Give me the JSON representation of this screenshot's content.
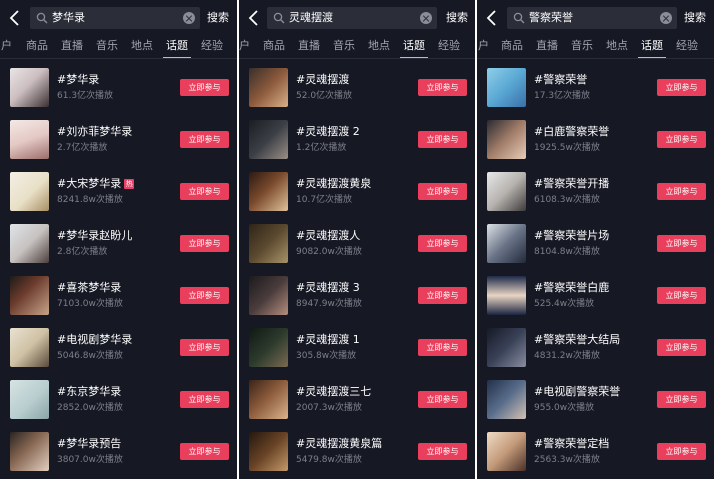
{
  "panels": [
    {
      "query": "梦华录",
      "search_label": "搜索",
      "tabs": [
        "户",
        "商品",
        "直播",
        "音乐",
        "地点",
        "话题",
        "经验"
      ],
      "active_tab": "话题",
      "topics": [
        {
          "title": "#梦华录",
          "plays": "61.3亿次播放",
          "join": "立即参与",
          "hot": false
        },
        {
          "title": "#刘亦菲梦华录",
          "plays": "2.7亿次播放",
          "join": "立即参与",
          "hot": false
        },
        {
          "title": "#大宋梦华录",
          "plays": "8241.8w次播放",
          "join": "立即参与",
          "hot": true,
          "hot_badge": "热"
        },
        {
          "title": "#梦华录赵盼儿",
          "plays": "2.8亿次播放",
          "join": "立即参与",
          "hot": false
        },
        {
          "title": "#喜茶梦华录",
          "plays": "7103.0w次播放",
          "join": "立即参与",
          "hot": false
        },
        {
          "title": "#电视剧梦华录",
          "plays": "5046.8w次播放",
          "join": "立即参与",
          "hot": false
        },
        {
          "title": "#东京梦华录",
          "plays": "2852.0w次播放",
          "join": "立即参与",
          "hot": false
        },
        {
          "title": "#梦华录预告",
          "plays": "3807.0w次播放",
          "join": "立即参与",
          "hot": false
        }
      ]
    },
    {
      "query": "灵魂摆渡",
      "search_label": "搜索",
      "tabs": [
        "户",
        "商品",
        "直播",
        "音乐",
        "地点",
        "话题",
        "经验"
      ],
      "active_tab": "话题",
      "topics": [
        {
          "title": "#灵魂摆渡",
          "plays": "52.0亿次播放",
          "join": "立即参与",
          "hot": false
        },
        {
          "title": "#灵魂摆渡 2",
          "plays": "1.2亿次播放",
          "join": "立即参与",
          "hot": false
        },
        {
          "title": "#灵魂摆渡黄泉",
          "plays": "10.7亿次播放",
          "join": "立即参与",
          "hot": false
        },
        {
          "title": "#灵魂摆渡人",
          "plays": "9082.0w次播放",
          "join": "立即参与",
          "hot": false
        },
        {
          "title": "#灵魂摆渡 3",
          "plays": "8947.9w次播放",
          "join": "立即参与",
          "hot": false
        },
        {
          "title": "#灵魂摆渡 1",
          "plays": "305.8w次播放",
          "join": "立即参与",
          "hot": false
        },
        {
          "title": "#灵魂摆渡三七",
          "plays": "2007.3w次播放",
          "join": "立即参与",
          "hot": false
        },
        {
          "title": "#灵魂摆渡黄泉篇",
          "plays": "5479.8w次播放",
          "join": "立即参与",
          "hot": false
        }
      ]
    },
    {
      "query": "警察荣誉",
      "search_label": "搜索",
      "tabs": [
        "户",
        "商品",
        "直播",
        "音乐",
        "地点",
        "话题",
        "经验"
      ],
      "active_tab": "话题",
      "topics": [
        {
          "title": "#警察荣誉",
          "plays": "17.3亿次播放",
          "join": "立即参与",
          "hot": false
        },
        {
          "title": "#白鹿警察荣誉",
          "plays": "1925.5w次播放",
          "join": "立即参与",
          "hot": false
        },
        {
          "title": "#警察荣誉开播",
          "plays": "6108.3w次播放",
          "join": "立即参与",
          "hot": false
        },
        {
          "title": "#警察荣誉片场",
          "plays": "8104.8w次播放",
          "join": "立即参与",
          "hot": false
        },
        {
          "title": "#警察荣誉白鹿",
          "plays": "525.4w次播放",
          "join": "立即参与",
          "hot": false
        },
        {
          "title": "#警察荣誉大结局",
          "plays": "4831.2w次播放",
          "join": "立即参与",
          "hot": false
        },
        {
          "title": "#电视剧警察荣誉",
          "plays": "955.0w次播放",
          "join": "立即参与",
          "hot": false
        },
        {
          "title": "#警察荣誉定档",
          "plays": "2563.3w次播放",
          "join": "立即参与",
          "hot": false
        }
      ]
    }
  ],
  "colors": {
    "background": "#161824",
    "search_field": "#2b2d39",
    "join_button": "#ea3f5c",
    "tab_indicator": "#f1c40f",
    "hot_badge": "#ea3f66",
    "secondary_text": "#7d7f8a"
  },
  "icons": {
    "back": "chevron-left-icon",
    "search": "search-icon",
    "clear": "clear-icon",
    "hot": "hot-badge"
  }
}
